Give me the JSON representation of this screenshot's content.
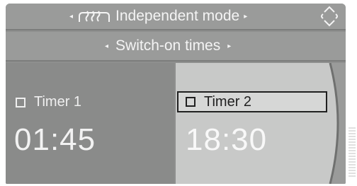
{
  "header": {
    "title": "Independent mode",
    "icon": "auxiliary-heating-icon",
    "left_arrow_icon": "arrow-left-icon",
    "right_arrow_icon": "arrow-right-icon",
    "scroll_icon": "up-down-scroll-icon"
  },
  "subheader": {
    "title": "Switch-on times",
    "left_arrow_icon": "arrow-left-icon",
    "right_arrow_icon": "arrow-right-icon"
  },
  "timers": [
    {
      "label": "Timer 1",
      "time": "01:45",
      "checked": false,
      "selected": false
    },
    {
      "label": "Timer 2",
      "time": "18:30",
      "checked": false,
      "selected": true
    }
  ],
  "colors": {
    "background": "#8e8f8e",
    "selected_panel": "#c8c9c8",
    "text_light": "#f4f4f4",
    "text_dark": "#202020"
  }
}
